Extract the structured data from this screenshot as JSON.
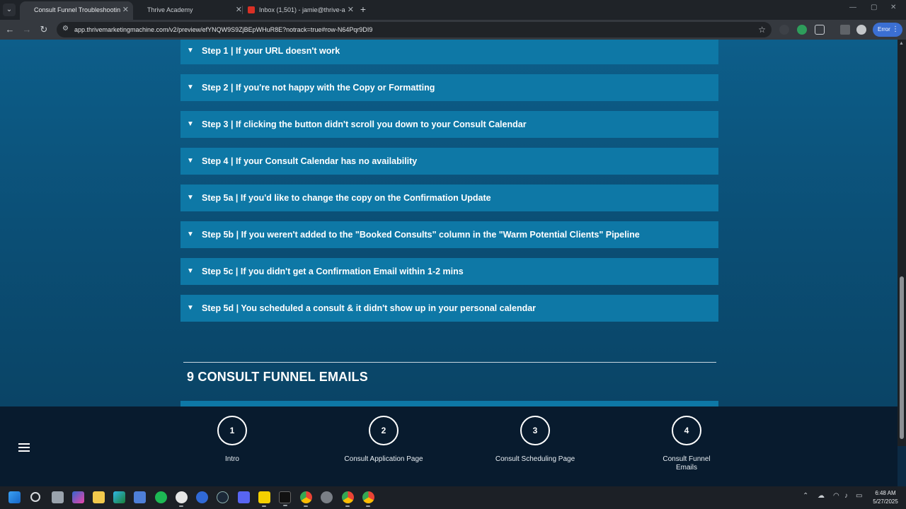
{
  "browser": {
    "tabs": [
      {
        "title": "Consult Funnel Troubleshootin",
        "active": true
      },
      {
        "title": "Thrive Academy",
        "active": false
      },
      {
        "title": "Inbox (1,501) - jamie@thrive-a",
        "active": false
      }
    ],
    "url": "app.thrivemarketingmachine.com/v2/preview/efYNQW9S9ZjBEpWHuR8E?notrack=true#row-N64Pqr9DI9",
    "error_label": "Error"
  },
  "accordion": [
    {
      "label": "Step 1 | If your URL doesn't work"
    },
    {
      "label": "Step 2 | If you're not happy with the Copy or Formatting"
    },
    {
      "label": "Step 3 | If clicking the button didn't scroll you down to your Consult Calendar"
    },
    {
      "label": "Step 4 | If your Consult Calendar has no availability"
    },
    {
      "label": "Step 5a | If you'd like to change the copy on the Confirmation Update"
    },
    {
      "label": "Step 5b | If you weren't added to the \"Booked Consults\" column in the \"Warm Potential Clients\" Pipeline"
    },
    {
      "label": "Step 5c | If you didn't get a Confirmation Email within 1-2 mins"
    },
    {
      "label": "Step 5d | You scheduled a consult & it didn't show up in your personal calendar"
    }
  ],
  "section": {
    "title": "9 CONSULT FUNNEL EMAILS"
  },
  "bottom_nav": {
    "steps": [
      {
        "number": "1",
        "label": "Intro"
      },
      {
        "number": "2",
        "label": "Consult Application Page"
      },
      {
        "number": "3",
        "label": "Consult Scheduling Page"
      },
      {
        "number": "4",
        "label": "Consult Funnel Emails"
      }
    ]
  },
  "taskbar": {
    "time": "6:48 AM",
    "date": "5/27/2025"
  },
  "colors": {
    "accordion_bg": "#0e78a6",
    "page_bg": "#0b4f76",
    "bottom_nav_bg": "#081b2e"
  }
}
